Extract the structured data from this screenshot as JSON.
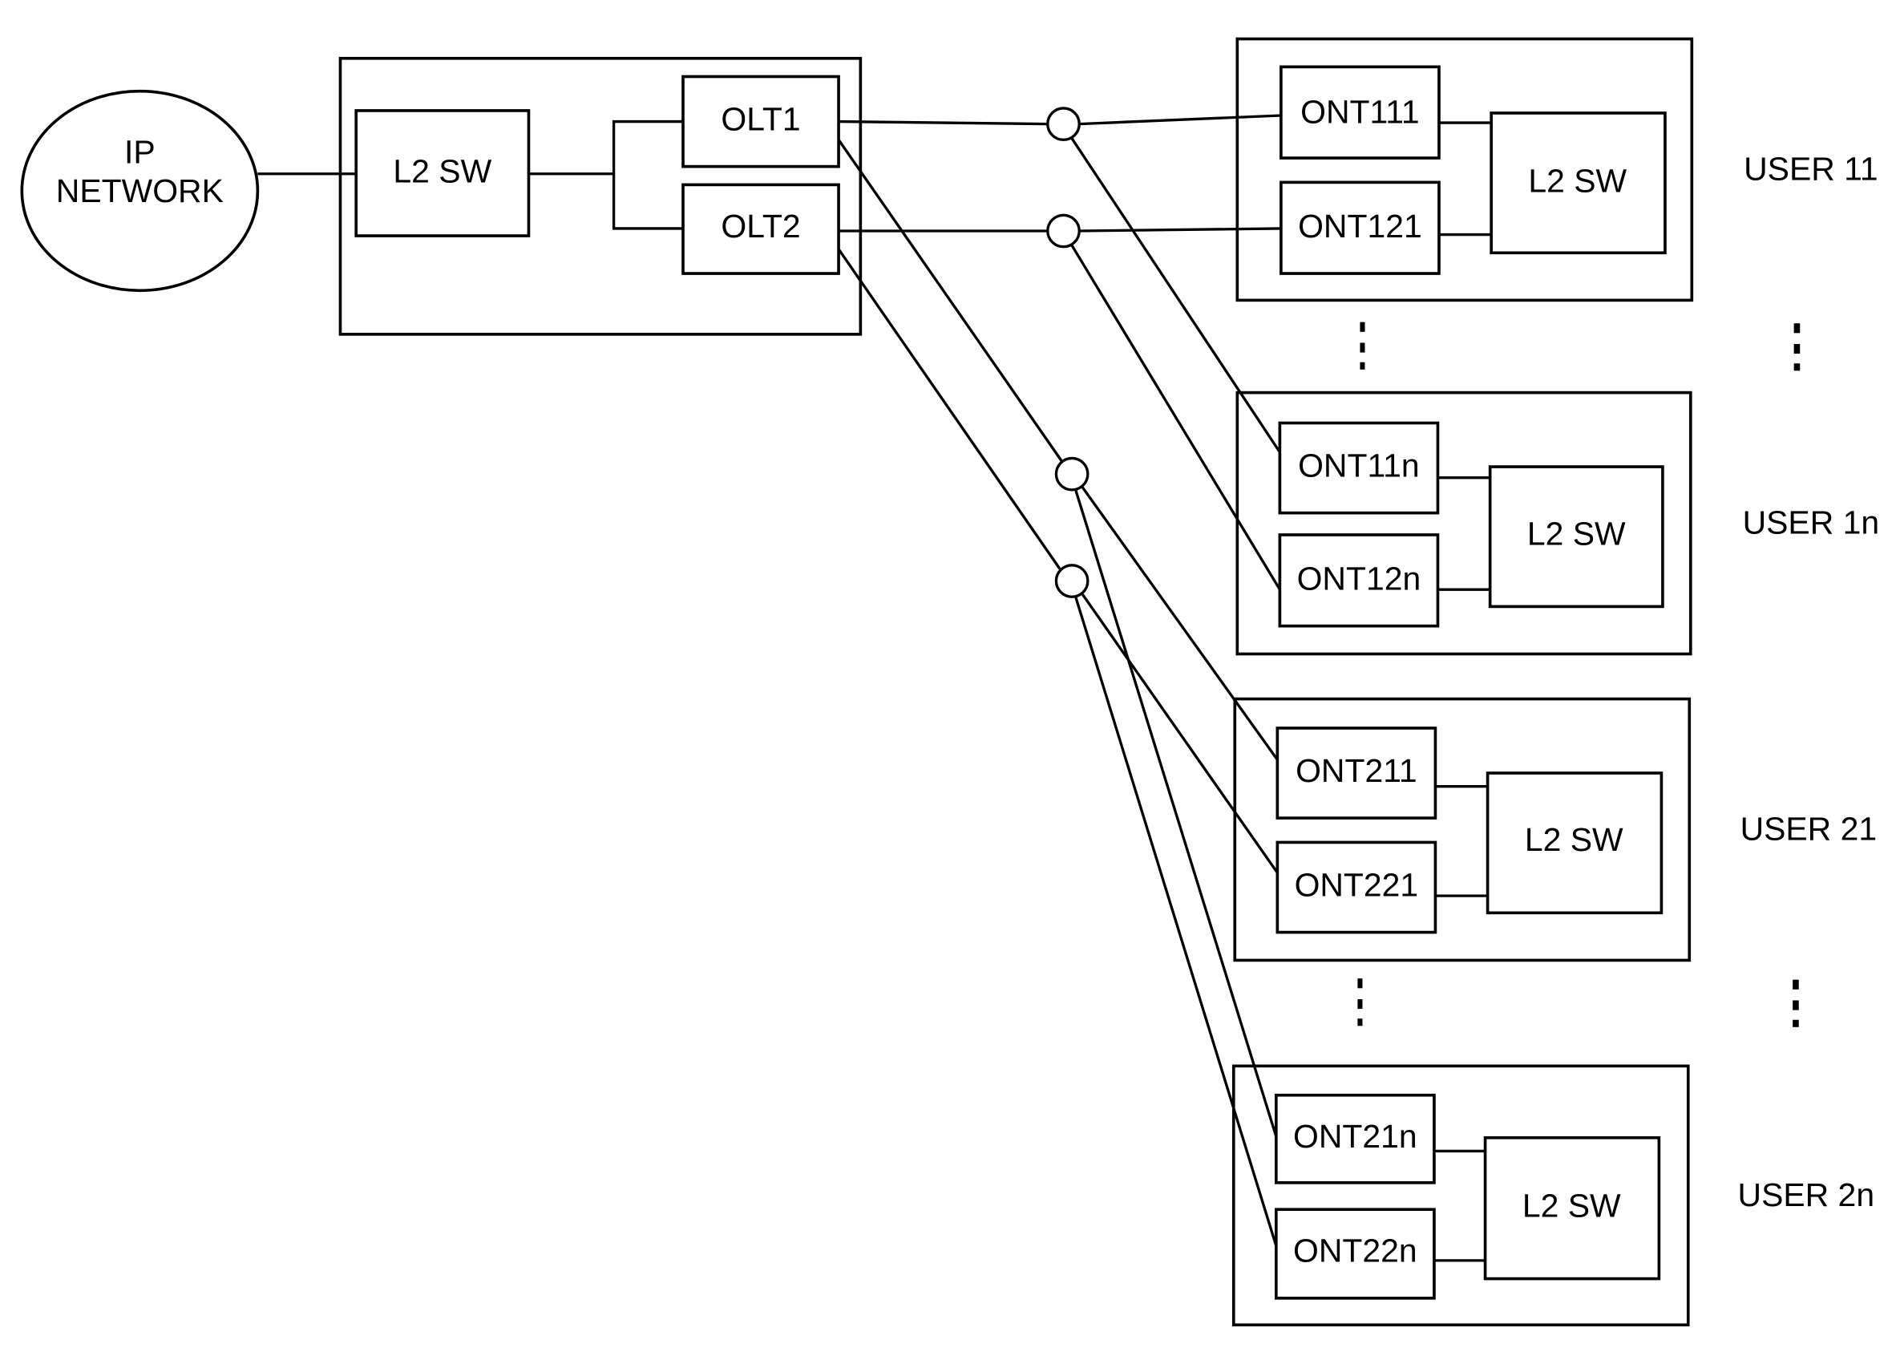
{
  "diagram": {
    "type": "network-topology",
    "ip_network": {
      "line1": "IP",
      "line2": "NETWORK"
    },
    "center": {
      "switch_label": "L2 SW",
      "olts": [
        {
          "label": "OLT1"
        },
        {
          "label": "OLT2"
        }
      ]
    },
    "user_groups": [
      {
        "label": "USER 11",
        "onts": [
          "ONT111",
          "ONT121"
        ],
        "switch_label": "L2 SW"
      },
      {
        "label": "USER 1n",
        "onts": [
          "ONT11n",
          "ONT12n"
        ],
        "switch_label": "L2 SW"
      },
      {
        "label": "USER 21",
        "onts": [
          "ONT211",
          "ONT221"
        ],
        "switch_label": "L2 SW"
      },
      {
        "label": "USER 2n",
        "onts": [
          "ONT21n",
          "ONT22n"
        ],
        "switch_label": "L2 SW"
      }
    ],
    "connections": [
      {
        "from": "IP NETWORK",
        "to": "L2 SW"
      },
      {
        "from": "L2 SW",
        "to": "OLT1"
      },
      {
        "from": "L2 SW",
        "to": "OLT2"
      },
      {
        "from": "OLT1",
        "via": "splitter-1",
        "to": [
          "ONT111",
          "ONT11n"
        ]
      },
      {
        "from": "OLT2",
        "via": "splitter-2",
        "to": [
          "ONT121",
          "ONT12n"
        ]
      },
      {
        "from": "OLT1",
        "via": "splitter-3",
        "to": [
          "ONT211",
          "ONT21n"
        ]
      },
      {
        "from": "OLT2",
        "via": "splitter-4",
        "to": [
          "ONT221",
          "ONT22n"
        ]
      }
    ]
  }
}
